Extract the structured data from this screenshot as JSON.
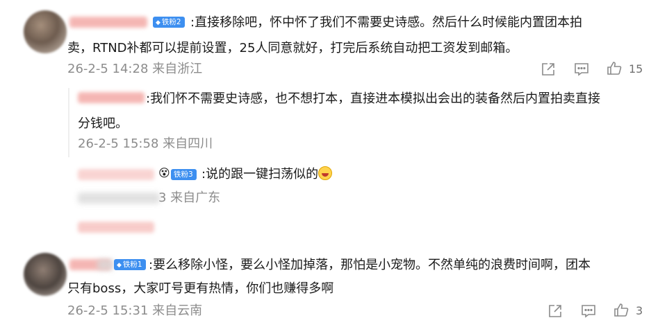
{
  "comments": [
    {
      "badge": "铁粉2",
      "text": ":直接移除吧，怀中怀了我们不需要史诗感。然后什么时候能内置团本拍卖，RTND补都可以提前设置，25人同意就好，打完后系统自动把工资发到邮箱。",
      "line1": ":直接移除吧，怀中怀了我们不需要史诗感。然后什么时候能内置团本拍",
      "line2": "卖，RTND补都可以提前设置，25人同意就好，打完后系统自动把工资发到邮箱。",
      "meta": "26-2-5 14:28 来自浙江",
      "likes": "15"
    },
    {
      "badge": "铁粉1",
      "line1": ":要么移除小怪，要么小怪加掉落，那怕是小宠物。不然单纯的浪费时间啊，团本",
      "line2": "只有boss，大家叮号更有热情，你们也赚得多啊",
      "meta": "26-2-5 15:31 来自云南",
      "likes": "3"
    }
  ],
  "replies": [
    {
      "line1": ":我们怀不需要史诗感，也不想打本，直接进本模拟出会出的装备然后内置拍卖直接",
      "line2": "分钱吧。",
      "meta": "26-2-5 15:58 来自四川"
    },
    {
      "badge": "铁粉3",
      "text": ":说的跟一键扫荡似的",
      "meta_partial": "3 来自广东"
    }
  ],
  "icons": [
    "share-icon",
    "comment-icon",
    "like-icon"
  ],
  "colors": {
    "badge": "#3d8ff0",
    "meta": "#8c8c8c",
    "name_blur": "#f3aaa6"
  }
}
